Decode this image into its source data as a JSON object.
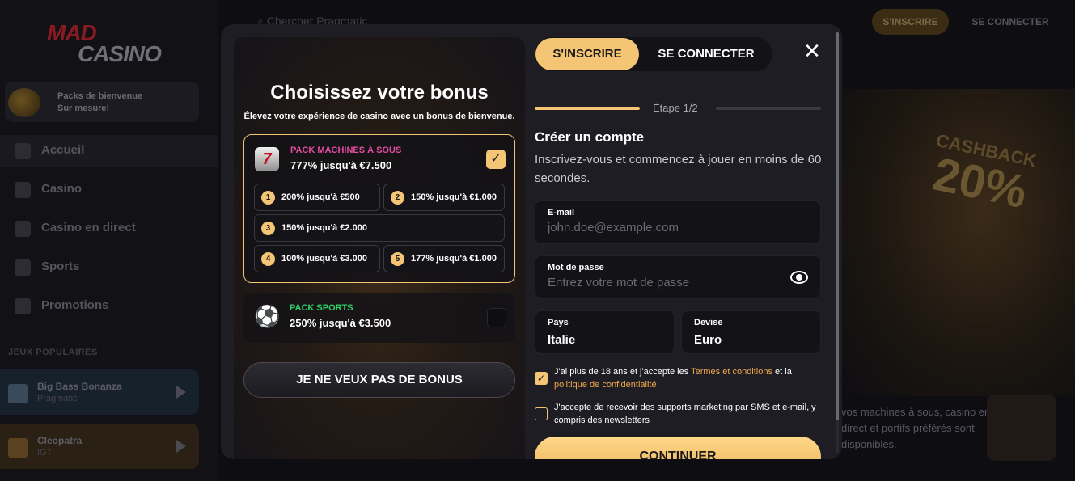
{
  "background": {
    "logo": {
      "mad": "MAD",
      "casino": "CASINO"
    },
    "promo": {
      "line1": "Packs de bienvenue",
      "line2": "Sur mesure!"
    },
    "nav": [
      "Accueil",
      "Casino",
      "Casino en direct",
      "Sports",
      "Promotions"
    ],
    "section_title": "JEUX POPULAIRES",
    "games": [
      {
        "name": "Big Bass Bonanza",
        "provider": "Pragmatic"
      },
      {
        "name": "Cleopatra",
        "provider": "IGT"
      }
    ],
    "search_placeholder": "Chercher Pragmatic",
    "header_signup": "S'INSCRIRE",
    "header_login": "SE CONNECTER",
    "hero_cashback": "CASHBACK",
    "hero_percent": "20%",
    "hero_text": "vos machines à sous, casino en direct et portifs préférés sont disponibles."
  },
  "bonus": {
    "title": "Choisissez votre bonus",
    "subtitle": "Élevez votre expérience de casino avec un bonus de bienvenue.",
    "slots": {
      "type": "PACK MACHINES À SOUS",
      "value": "777% jusqu'à €7.500",
      "icon": "7",
      "tiers": [
        {
          "n": "1",
          "label": "200% jusqu'à €500"
        },
        {
          "n": "2",
          "label": "150% jusqu'à €1.000"
        },
        {
          "n": "3",
          "label": "150% jusqu'à €2.000"
        },
        {
          "n": "4",
          "label": "100% jusqu'à €3.000"
        },
        {
          "n": "5",
          "label": "177% jusqu'à €1.000"
        }
      ]
    },
    "sports": {
      "type": "PACK SPORTS",
      "value": "250% jusqu'à €3.500",
      "icon": "⚽"
    },
    "no_bonus": "JE NE VEUX PAS DE BONUS"
  },
  "auth": {
    "tab_signup": "S'INSCRIRE",
    "tab_login": "SE CONNECTER",
    "close": "✕",
    "step": "Étape 1/2",
    "progress": 0.5,
    "title": "Créer un compte",
    "subtitle": "Inscrivez-vous et commencez à jouer en moins de 60 secondes.",
    "email": {
      "label": "E-mail",
      "placeholder": "john.doe@example.com",
      "value": ""
    },
    "password": {
      "label": "Mot de passe",
      "placeholder": "Entrez votre mot de passe",
      "value": ""
    },
    "country": {
      "label": "Pays",
      "value": "Italie"
    },
    "currency": {
      "label": "Devise",
      "value": "Euro"
    },
    "consent1": {
      "checked": true,
      "text_a": "J'ai plus de 18 ans et j'accepte les ",
      "link1": "Termes et conditions",
      "text_b": " et la ",
      "link2": "politique de confidentialité"
    },
    "consent2": {
      "checked": false,
      "text": "J'accepte de recevoir des supports marketing par SMS et e-mail, y compris des newsletters"
    },
    "continue": "CONTINUER"
  },
  "colors": {
    "accent": "#f3c575",
    "slots_type": "#e64ba3",
    "sports_type": "#2fd06a",
    "link": "#f3a94b"
  }
}
